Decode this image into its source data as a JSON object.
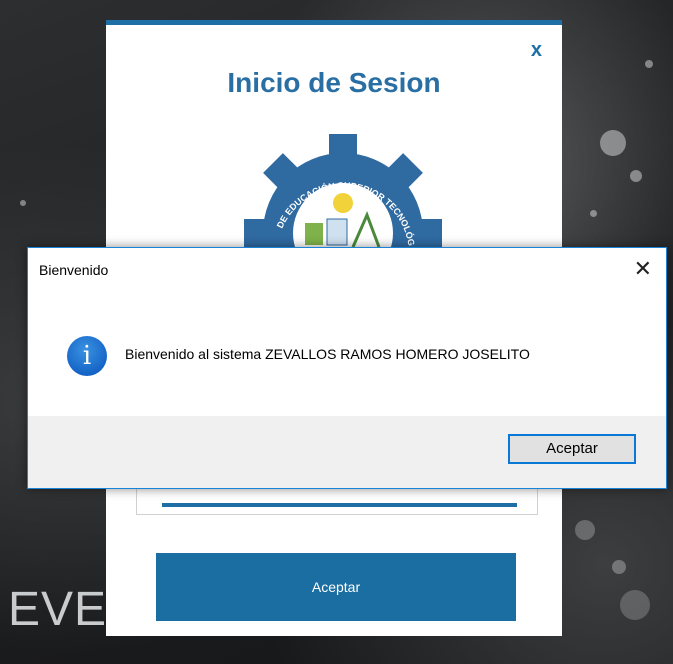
{
  "login": {
    "title": "Inicio de Sesion",
    "close_label": "x",
    "accept_label": "Aceptar",
    "logo_text": "DE EDUCACIÓN SUPERIOR TECNOLÓGICO"
  },
  "background": {
    "brand_text": "EVE"
  },
  "messagebox": {
    "title": "Bienvenido",
    "close_label": "✕",
    "icon_glyph": "i",
    "icon": "info-icon",
    "message": "Bienvenido al sistema ZEVALLOS RAMOS HOMERO JOSELITO",
    "ok_label": "Aceptar"
  },
  "colors": {
    "accent": "#1d6fa6",
    "button": "#1a6ea2",
    "focus": "#0a78d7"
  }
}
